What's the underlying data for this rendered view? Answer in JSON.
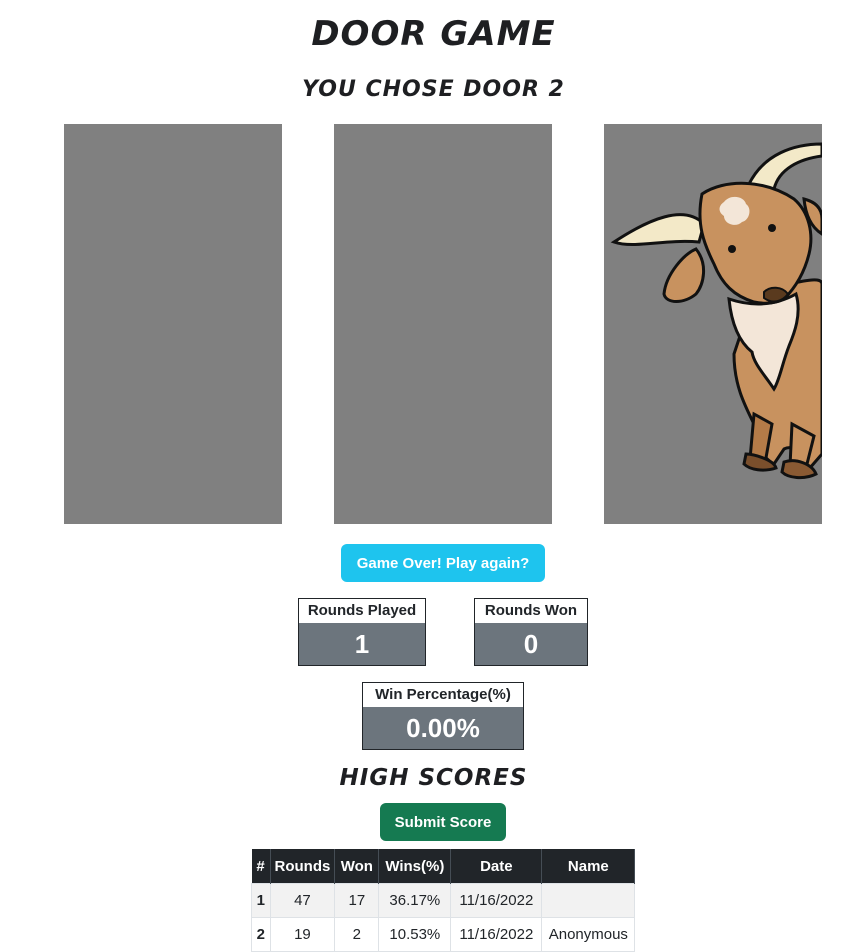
{
  "title": "Door Game",
  "subtitle": "You chose Door 2",
  "doors": [
    {
      "reveal": "closed"
    },
    {
      "reveal": "closed"
    },
    {
      "reveal": "goat"
    }
  ],
  "play_again_label": "Game Over! Play again?",
  "stats": {
    "rounds_played_label": "Rounds Played",
    "rounds_played": "1",
    "rounds_won_label": "Rounds Won",
    "rounds_won": "0",
    "win_pct_label": "Win Percentage(%)",
    "win_pct": "0.00%"
  },
  "high_scores_title": "High Scores",
  "submit_label": "Submit Score",
  "table": {
    "headers": [
      "#",
      "Rounds",
      "Won",
      "Wins(%)",
      "Date",
      "Name"
    ],
    "rows": [
      [
        "1",
        "47",
        "17",
        "36.17%",
        "11/16/2022",
        ""
      ],
      [
        "2",
        "19",
        "2",
        "10.53%",
        "11/16/2022",
        "Anonymous"
      ]
    ]
  },
  "colors": {
    "door": "#808080",
    "play_again": "#1ec4ee",
    "submit": "#157a51",
    "stat_value_bg": "#6c757d",
    "table_header": "#212529"
  }
}
